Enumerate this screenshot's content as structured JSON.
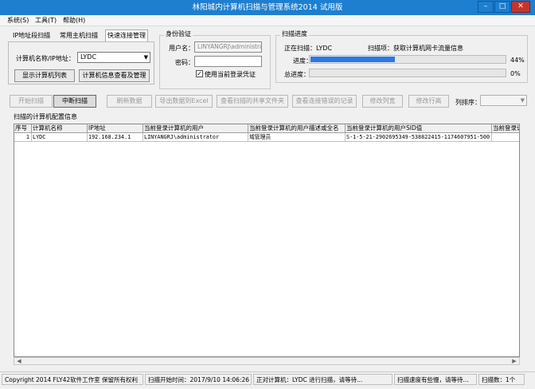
{
  "window": {
    "title": "林阳城内计算机扫描与管理系统2014 试用版",
    "controls": {
      "minimize": "–",
      "maximize": "□",
      "close": "✕"
    }
  },
  "menu": [
    "系统(S)",
    "工具(T)",
    "帮助(H)"
  ],
  "scan_mode_tabs": [
    "IP地址段扫描",
    "常用主机扫描",
    "快速连接管理"
  ],
  "quick_connect": {
    "label": "计算机名称/IP地址：",
    "value": "LYDC",
    "show_list_button": "显示计算机列表",
    "view_info_button": "计算机信息查看及管理"
  },
  "auth": {
    "group_title": "身份验证",
    "user_label": "用户名：",
    "user_value": "LINYANGRJ\\administrator",
    "password_label": "密码：",
    "password_value": "",
    "use_current_label": "使用当前登录凭证",
    "use_current_checked": true
  },
  "progress": {
    "group_title": "扫描进度",
    "scanning_label": "正在扫描：LYDC",
    "scan_item_label": "扫描项：获取计算机网卡流量信息",
    "progress_label": "进度：",
    "progress_value": 0.44,
    "progress_text": "44%",
    "total_label": "总进度：",
    "total_value": 0,
    "total_text": "0%"
  },
  "toolbar": {
    "start": "开始扫描",
    "stop": "中断扫描",
    "refresh": "刷新数据",
    "export": "导出数据到Excel",
    "shared_folders": "查看扫描的共享文件夹",
    "error_log": "查看连接错误的记录",
    "edit_columns": "修改列宽",
    "edit_rows": "修改行高",
    "sort_label": "列排序："
  },
  "table": {
    "title": "扫描的计算机配置信息",
    "columns": [
      "序号",
      "计算机名称",
      "IP地址",
      "当前登录计算机的用户",
      "当前登录计算机的用户描述或全名",
      "当前登录计算机的用户SID值",
      "当前登录计"
    ],
    "rows": [
      [
        "1",
        "LYDC",
        "192.168.234.1",
        "LINYANGRJ\\administrator",
        "域管理员",
        "S-1-5-21-2902695349-538822415-1174607951-500",
        ""
      ]
    ]
  },
  "status": {
    "copyright": "Copyright 2014 FLY42软件工作室 保留所有权利",
    "start_time": "扫描开始时间：2017/9/10 14:06:26",
    "current": "正对计算机：LYDC 进行扫描，请等待...",
    "speed": "扫描速度有些慢，请等待...",
    "count": "扫描数：1个"
  }
}
